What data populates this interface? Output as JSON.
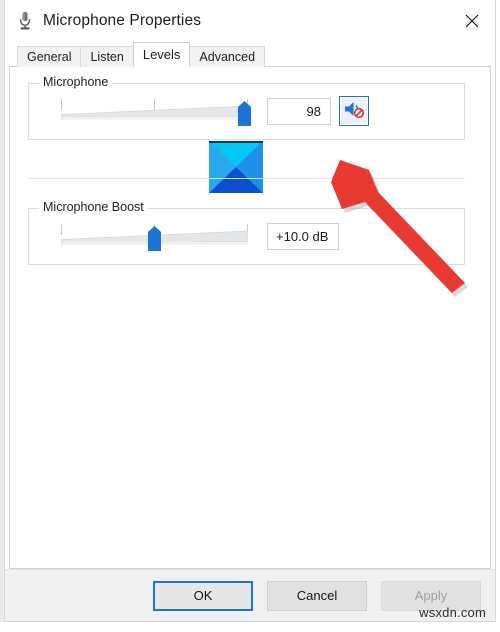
{
  "window": {
    "title": "Microphone Properties",
    "title_icon": "microphone-icon",
    "close_label": "close-icon"
  },
  "tabs": [
    {
      "label": "General",
      "active": false
    },
    {
      "label": "Listen",
      "active": false
    },
    {
      "label": "Levels",
      "active": true
    },
    {
      "label": "Advanced",
      "active": false
    }
  ],
  "microphone_group": {
    "title": "Microphone",
    "value": "98",
    "slider_percent": 98,
    "mute_button_icon": "speaker-mute-icon",
    "mute_button_state": "muted"
  },
  "boost_group": {
    "title": "Microphone Boost",
    "value": "+10.0 dB",
    "slider_percent": 50
  },
  "broken_image": {
    "alt": "broken-image-placeholder"
  },
  "footer": {
    "ok_label": "OK",
    "cancel_label": "Cancel",
    "apply_label": "Apply",
    "apply_disabled": true
  },
  "watermark": {
    "text": "wsxdn.com"
  },
  "annotation": {
    "type": "arrow",
    "color": "#e8382f",
    "points_at": "mute-button"
  },
  "colors": {
    "accent": "#1a76d2",
    "slider_thumb": "#1a76d2",
    "arrow": "#e8382f",
    "window_bg": "#ffffff",
    "footer_bg": "#f0f0f0"
  }
}
